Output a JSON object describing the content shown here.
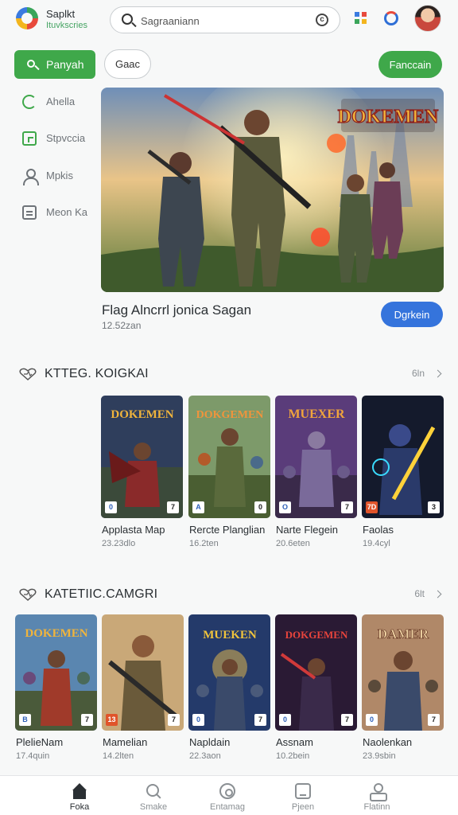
{
  "header": {
    "app_name": "Saplkt",
    "app_subtitle": "Ituvkscries",
    "search_placeholder": "Sagraaniann"
  },
  "actions": {
    "primary_label": "Panyah",
    "chip_label": "Gaac",
    "right_label": "Fanccain"
  },
  "sidebar": {
    "items": [
      {
        "label": "Ahella",
        "icon": "refresh-icon"
      },
      {
        "label": "Stpvccia",
        "icon": "document-icon"
      },
      {
        "label": "Mpkis",
        "icon": "user-icon"
      },
      {
        "label": "Meon Ka",
        "icon": "calendar-icon"
      }
    ]
  },
  "hero": {
    "logo_text": "DOKEMEN",
    "title": "Flag Alncrrl jonica Sagan",
    "meta": "12.52zan",
    "button_label": "Dgrkein"
  },
  "sections": [
    {
      "title": "KTTEG. KOIGKAI",
      "more": "6ln",
      "cards": [
        {
          "title": "Applasta Map",
          "meta": "23.23dlo",
          "logo": "DOKEMEN",
          "badge_left": "0",
          "badge_right": "7"
        },
        {
          "title": "Rercte Planglian",
          "meta": "16.2ten",
          "logo": "DOKGEMEN",
          "badge_left": "A",
          "badge_right": "0"
        },
        {
          "title": "Narte Flegein",
          "meta": "20.6eten",
          "logo": "MUEXER",
          "badge_left": "O",
          "badge_right": "7"
        },
        {
          "title": "Faolas",
          "meta": "19.4cyl",
          "logo": "",
          "badge_left": "7D",
          "badge_right": "3"
        }
      ]
    },
    {
      "title": "KATETIIC.CAMGRI",
      "more": "6lt",
      "cards": [
        {
          "title": "PlelieNam",
          "meta": "17.4quin",
          "logo": "DOKEMEN",
          "badge_left": "B",
          "badge_right": "7"
        },
        {
          "title": "Mamelian",
          "meta": "14.2lten",
          "logo": "",
          "badge_left": "13",
          "badge_right": "7"
        },
        {
          "title": "Napldain",
          "meta": "22.3aon",
          "logo": "MUEKEN",
          "badge_left": "0",
          "badge_right": "7"
        },
        {
          "title": "Assnam",
          "meta": "10.2bein",
          "logo": "DOKGEMEN",
          "badge_left": "0",
          "badge_right": "7"
        },
        {
          "title": "Naolenkan",
          "meta": "23.9sbin",
          "logo": "DAMER",
          "badge_left": "0",
          "badge_right": "7"
        }
      ]
    }
  ],
  "bottom_nav": [
    {
      "label": "Foka",
      "icon": "home-icon",
      "active": true
    },
    {
      "label": "Smake",
      "icon": "search-icon",
      "active": false
    },
    {
      "label": "Entamag",
      "icon": "entertainment-icon",
      "active": false
    },
    {
      "label": "Pjeen",
      "icon": "media-icon",
      "active": false
    },
    {
      "label": "Flatinn",
      "icon": "profile-icon",
      "active": false
    }
  ],
  "colors": {
    "accent_green": "#3fa84a",
    "accent_blue": "#3574dc",
    "background": "#f7f8f8"
  }
}
